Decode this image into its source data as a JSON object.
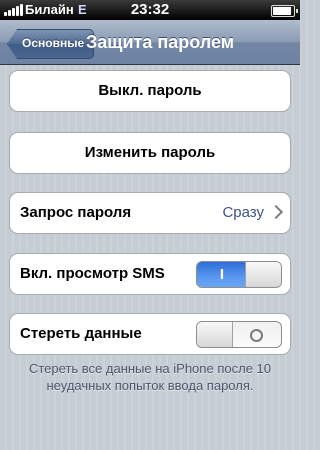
{
  "status_bar": {
    "carrier": "Билайн",
    "network": "E",
    "time": "23:32"
  },
  "nav": {
    "back_label": "Основные",
    "title": "Защита паролем"
  },
  "cells": {
    "disable_passcode": "Выкл. пароль",
    "change_passcode": "Изменить пароль",
    "require_passcode": {
      "label": "Запрос пароля",
      "value": "Сразу"
    },
    "sms_preview": {
      "label": "Вкл. просмотр SMS",
      "state": "on",
      "on_text": "I"
    },
    "erase_data": {
      "label": "Стереть данные",
      "state": "off"
    }
  },
  "footer_note": "Стереть все данные на iPhone после 10 неудачных попыток ввода пароля.",
  "colors": {
    "accent": "#385487",
    "switch_on": "#4a88e8",
    "nav": "#6d83a2"
  }
}
